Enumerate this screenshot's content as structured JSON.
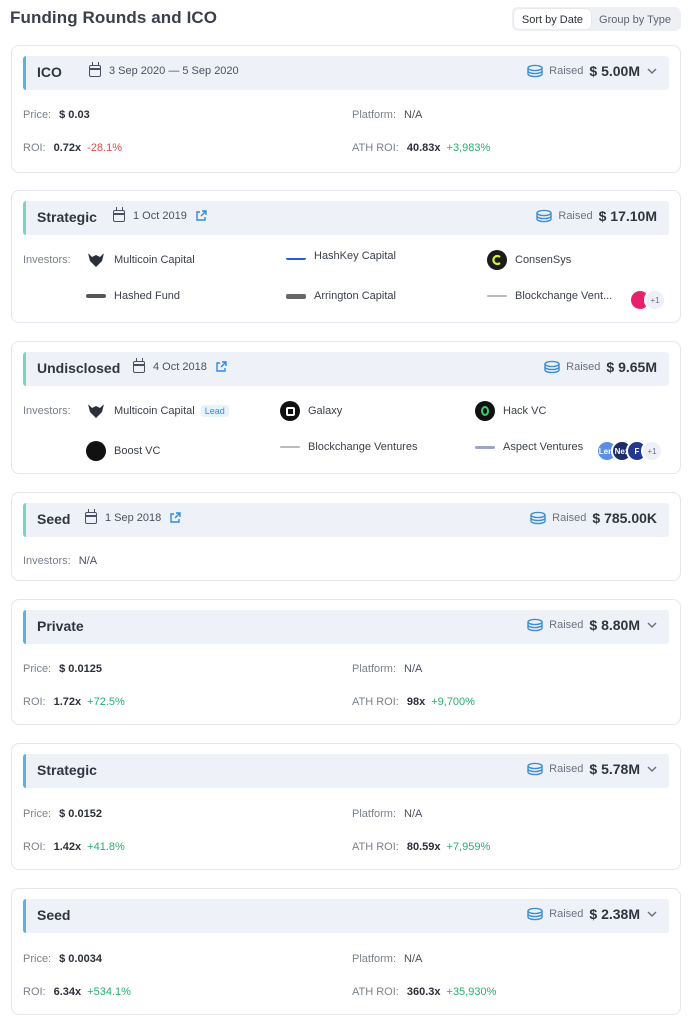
{
  "header": {
    "title": "Funding Rounds and ICO",
    "sort_by_date": "Sort by Date",
    "group_by_type": "Group by Type"
  },
  "colors": {
    "accent": "#5fb0e0",
    "accent_alt": "#7fd1c2",
    "positive": "#26b071",
    "negative": "#e04b4b"
  },
  "labels": {
    "raised": "Raised",
    "price": "Price:",
    "platform": "Platform:",
    "roi": "ROI:",
    "ath_roi": "ATH ROI:",
    "investors": "Investors:"
  },
  "rounds": [
    {
      "type": "ICO",
      "date": "3 Sep 2020 — 5 Sep 2020",
      "raised": "$ 5.00M",
      "price": "$ 0.03",
      "platform": "N/A",
      "roi": "0.72x",
      "roi_pct": "-28.1%",
      "ath_roi": "40.83x",
      "ath_roi_pct": "+3,983%"
    },
    {
      "type": "Strategic",
      "date": "1 Oct 2019",
      "raised": "$ 17.10M",
      "investors": [
        {
          "name": "Multicoin Capital",
          "icon": "multicoin-logo-icon"
        },
        {
          "name": "HashKey Capital",
          "icon": "hashkey-logo-icon"
        },
        {
          "name": "ConsenSys",
          "icon": "consensys-logo-icon"
        },
        {
          "name": "Hashed Fund",
          "icon": "hashed-logo-icon"
        },
        {
          "name": "Arrington Capital",
          "icon": "arrington-logo-icon"
        },
        {
          "name": "Blockchange Vent...",
          "icon": "blockchange-logo-icon"
        }
      ],
      "more": "+1"
    },
    {
      "type": "Undisclosed",
      "date": "4 Oct 2018",
      "raised": "$ 9.65M",
      "investors": [
        {
          "name": "Multicoin Capital",
          "icon": "multicoin-logo-icon",
          "badge": "Lead"
        },
        {
          "name": "Galaxy",
          "icon": "galaxy-logo-icon"
        },
        {
          "name": "Hack VC",
          "icon": "hackvc-logo-icon"
        },
        {
          "name": "Boost VC",
          "icon": "boostvc-logo-icon"
        },
        {
          "name": "Blockchange Ventures",
          "icon": "blockchange-logo-icon"
        },
        {
          "name": "Aspect Ventures",
          "icon": "aspect-logo-icon"
        }
      ],
      "stack": [
        "Lem",
        "Nex",
        "F"
      ],
      "more": "+1"
    },
    {
      "type": "Seed",
      "date": "1 Sep 2018",
      "raised": "$ 785.00K",
      "investors_text": "N/A"
    },
    {
      "type": "Private",
      "raised": "$ 8.80M",
      "price": "$ 0.0125",
      "platform": "N/A",
      "roi": "1.72x",
      "roi_pct": "+72.5%",
      "ath_roi": "98x",
      "ath_roi_pct": "+9,700%"
    },
    {
      "type": "Strategic",
      "raised": "$ 5.78M",
      "price": "$ 0.0152",
      "platform": "N/A",
      "roi": "1.42x",
      "roi_pct": "+41.8%",
      "ath_roi": "80.59x",
      "ath_roi_pct": "+7,959%"
    },
    {
      "type": "Seed",
      "raised": "$ 2.38M",
      "price": "$ 0.0034",
      "platform": "N/A",
      "roi": "6.34x",
      "roi_pct": "+534.1%",
      "ath_roi": "360.3x",
      "ath_roi_pct": "+35,930%"
    }
  ]
}
